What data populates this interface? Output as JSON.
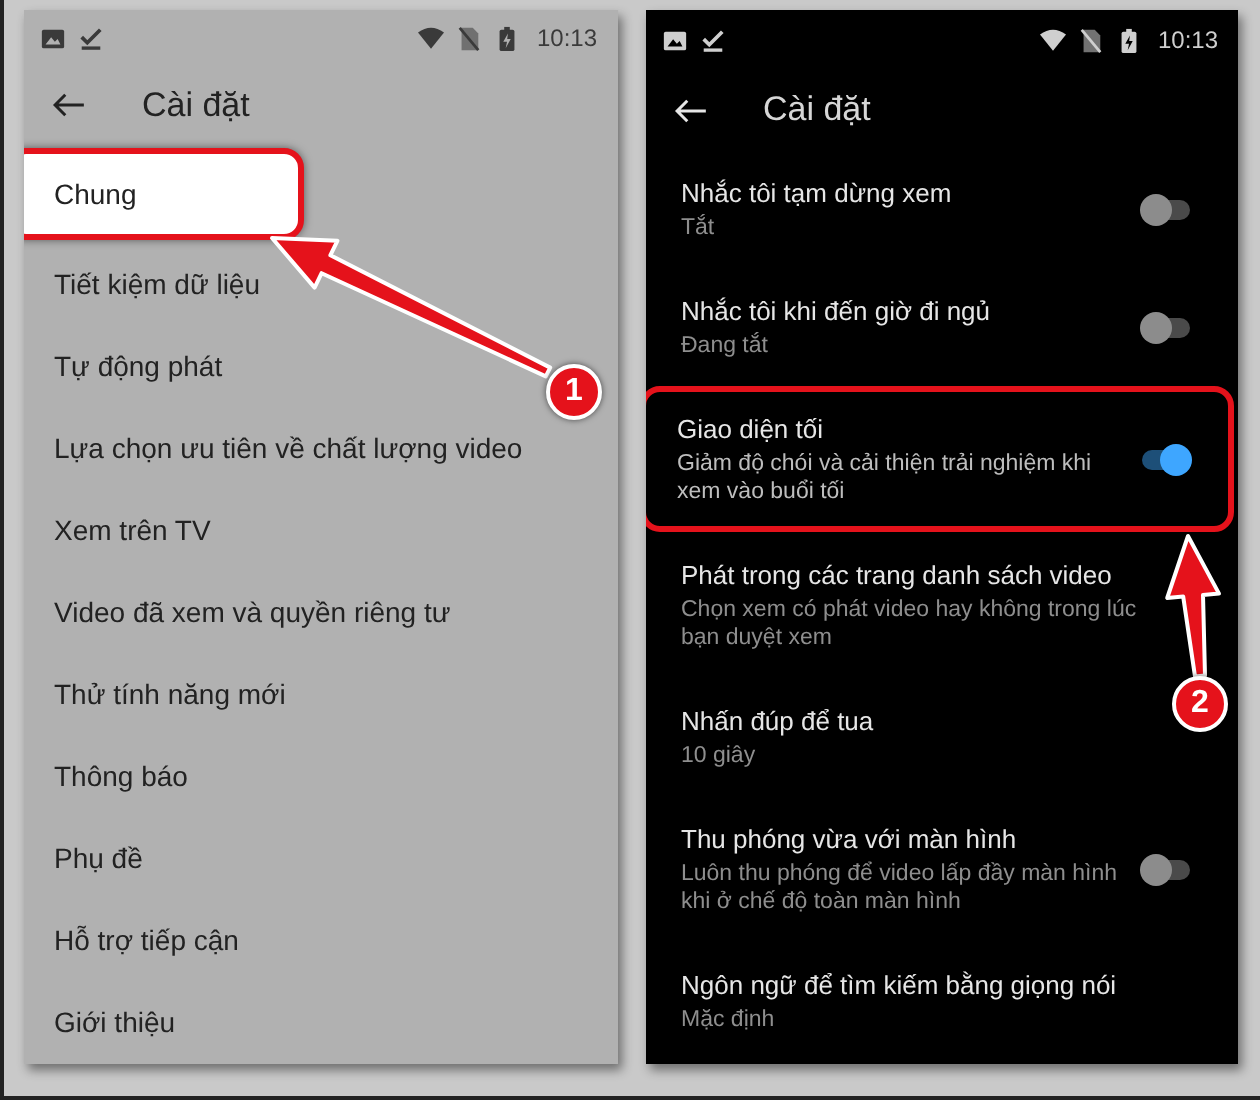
{
  "panels": [
    {
      "kind": "light",
      "status_bar": {
        "time": "10:13"
      },
      "title": "Cài đặt",
      "callout": "1",
      "items": [
        {
          "title": "Chung",
          "highlighted": true
        },
        {
          "title": "Tiết kiệm dữ liệu",
          "highlighted": false
        },
        {
          "title": "Tự động phát",
          "highlighted": false
        },
        {
          "title": "Lựa chọn ưu tiên về chất lượng video",
          "highlighted": false
        },
        {
          "title": "Xem trên TV",
          "highlighted": false
        },
        {
          "title": "Video đã xem và quyền riêng tư",
          "highlighted": false
        },
        {
          "title": "Thử tính năng mới",
          "highlighted": false
        },
        {
          "title": "Thông báo",
          "highlighted": false
        },
        {
          "title": "Phụ đề",
          "highlighted": false
        },
        {
          "title": "Hỗ trợ tiếp cận",
          "highlighted": false
        },
        {
          "title": "Giới thiệu",
          "highlighted": false
        }
      ]
    },
    {
      "kind": "dark",
      "status_bar": {
        "time": "10:13"
      },
      "title": "Cài đặt",
      "callout": "2",
      "items": [
        {
          "title": "Nhắc tôi tạm dừng xem",
          "subtitle": "Tắt",
          "toggle": {
            "on": false
          },
          "highlighted": false
        },
        {
          "title": "Nhắc tôi khi đến giờ đi ngủ",
          "subtitle": "Đang tắt",
          "toggle": {
            "on": false
          },
          "highlighted": false
        },
        {
          "title": "Giao diện tối",
          "subtitle": "Giảm độ chói và cải thiện trải nghiệm khi xem vào buổi tối",
          "toggle": {
            "on": true
          },
          "highlighted": true
        },
        {
          "title": "Phát trong các trang danh sách video",
          "subtitle": "Chọn xem có phát video hay không trong lúc bạn duyệt xem",
          "highlighted": false
        },
        {
          "title": "Nhấn đúp để tua",
          "subtitle": "10 giây",
          "highlighted": false
        },
        {
          "title": "Thu phóng vừa với màn hình",
          "subtitle": "Luôn thu phóng để video lấp đầy màn hình khi ở chế độ toàn màn hình",
          "toggle": {
            "on": false
          },
          "highlighted": false
        },
        {
          "title": "Ngôn ngữ để tìm kiếm bằng giọng nói",
          "subtitle": "Mặc định",
          "highlighted": false
        }
      ]
    }
  ]
}
